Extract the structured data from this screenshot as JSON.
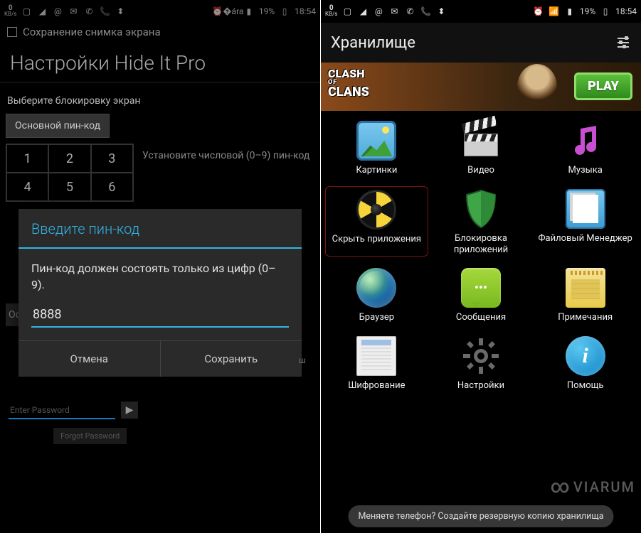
{
  "status": {
    "kbs_value": "0",
    "kbs_unit": "KB/s",
    "battery_pct": "19%",
    "time": "18:54"
  },
  "left": {
    "toast": "Сохранение снимка экрана",
    "title": "Настройки Hide It Pro",
    "subtitle": "Выберите блокировку экран",
    "tab_primary": "Основной пин-код",
    "hint": "Установите числовой (0–9) пин-код",
    "keypad": [
      "1",
      "2",
      "3",
      "4",
      "5",
      "6"
    ],
    "tab_confirm": "Ос",
    "enter_pw_placeholder": "Enter Password",
    "forgot": "Forgot Password",
    "dialog": {
      "title": "Введите пин-код",
      "message": "Пин-код должен состоять только из цифр (0–9).",
      "value": "8888",
      "cancel": "Отмена",
      "save": "Сохранить"
    }
  },
  "right": {
    "header": "Хранилище",
    "ad": {
      "brand_top": "CLASH",
      "brand_mid": "OF",
      "brand_bot": "CLANS",
      "play": "PLAY"
    },
    "apps": [
      {
        "id": "pictures",
        "label": "Картинки"
      },
      {
        "id": "video",
        "label": "Видео"
      },
      {
        "id": "music",
        "label": "Музыка"
      },
      {
        "id": "hide",
        "label": "Скрыть приложения",
        "highlight": true
      },
      {
        "id": "lock",
        "label": "Блокировка приложений"
      },
      {
        "id": "fm",
        "label": "Файловый Менеджер"
      },
      {
        "id": "browser",
        "label": "Браузер"
      },
      {
        "id": "msg",
        "label": "Сообщения"
      },
      {
        "id": "notes",
        "label": "Примечания"
      },
      {
        "id": "encrypt",
        "label": "Шифрование"
      },
      {
        "id": "settings",
        "label": "Настройки"
      },
      {
        "id": "help",
        "label": "Помощь"
      }
    ],
    "toast": "Меняете телефон? Создайте резервную копию хранилища"
  },
  "watermark": "VIARUM"
}
